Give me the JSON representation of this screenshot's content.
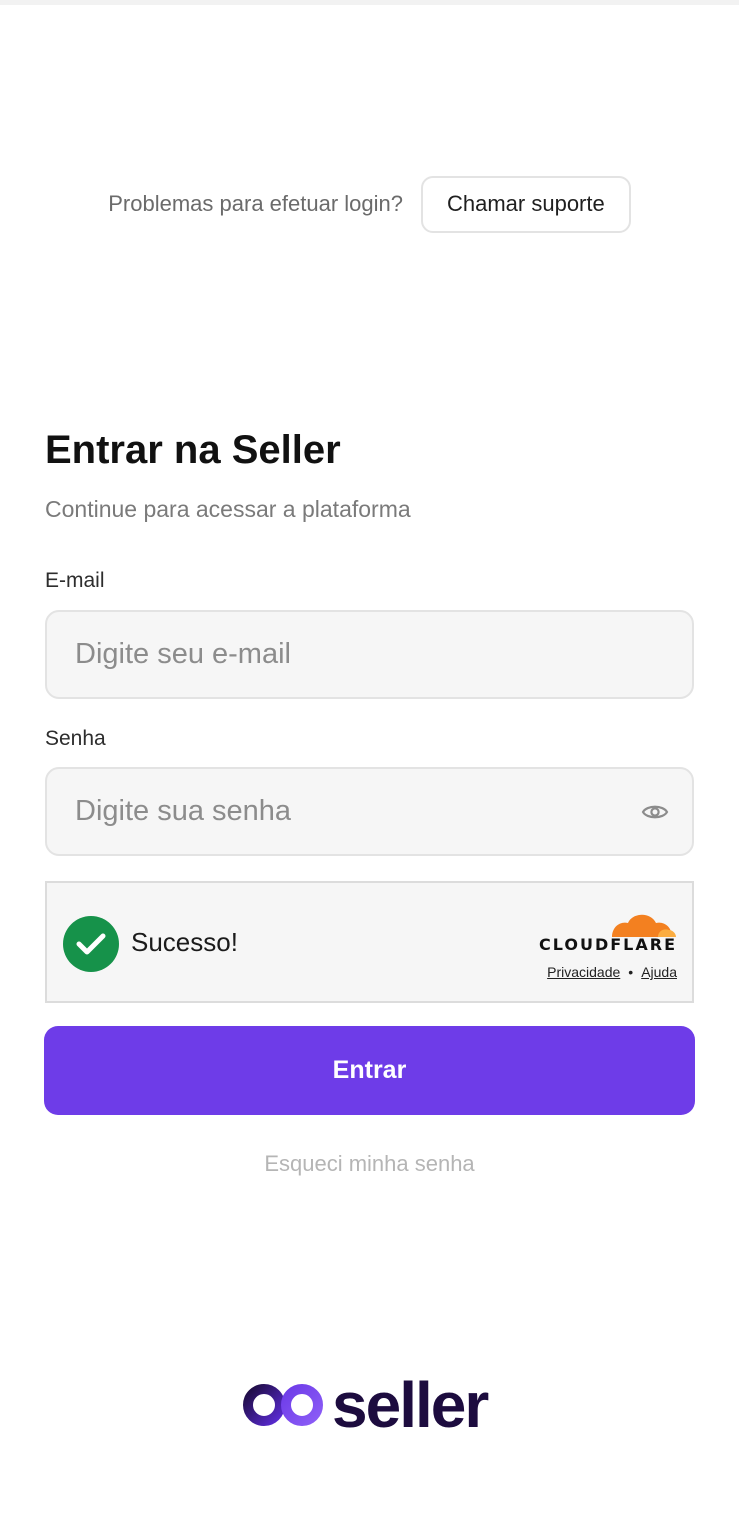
{
  "support": {
    "question": "Problemas para efetuar login?",
    "button_label": "Chamar suporte"
  },
  "login": {
    "title": "Entrar na Seller",
    "subtitle": "Continue para acessar a plataforma",
    "email_label": "E-mail",
    "email_placeholder": "Digite seu e-mail",
    "email_value": "",
    "password_label": "Senha",
    "password_placeholder": "Digite sua senha",
    "password_value": "",
    "submit_label": "Entrar",
    "forgot_label": "Esqueci minha senha"
  },
  "captcha": {
    "status_text": "Sucesso!",
    "provider": "CLOUDFLARE",
    "privacy_label": "Privacidade",
    "separator": "•",
    "help_label": "Ajuda",
    "success_color": "#16924a"
  },
  "brand": {
    "name": "seller",
    "accent": "#6e3ce8",
    "dark": "#1d0c3f"
  },
  "icons": {
    "eye": "eye-icon",
    "check": "check-icon",
    "cloud": "cloudflare-cloud-icon"
  }
}
